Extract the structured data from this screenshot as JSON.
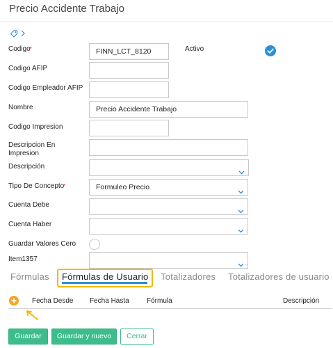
{
  "header": {
    "title": "Precio Accidente Trabajo"
  },
  "form": {
    "codigo": {
      "label": "Codigo",
      "value": "FINN_LCT_8120"
    },
    "activo": {
      "label": "Activo",
      "checked": true
    },
    "codigo_afip": {
      "label": "Codigo AFIP",
      "value": ""
    },
    "codigo_empleador_afip": {
      "label": "Codigo Empleador AFIP",
      "value": ""
    },
    "nombre": {
      "label": "Nombre",
      "value": "Precio Accidente Trabajo"
    },
    "codigo_impresion": {
      "label": "Codigo Impresion",
      "value": ""
    },
    "descripcion_en_impresion": {
      "label_line1": "Descripcion En",
      "label_line2": "Impresion",
      "value": ""
    },
    "descripcion": {
      "label": "Descripción",
      "value": ""
    },
    "tipo_de_concepto": {
      "label": "Tipo De Concepto",
      "value": "Formuleo Precio"
    },
    "cuenta_debe": {
      "label": "Cuenta Debe",
      "value": ""
    },
    "cuenta_haber": {
      "label": "Cuenta Haber",
      "value": ""
    },
    "guardar_valores_cero": {
      "label": "Guardar Valores Cero",
      "checked": false
    },
    "item1357": {
      "label": "Item1357",
      "value": ""
    },
    "required_mark": "*"
  },
  "tabs": [
    {
      "label": "Fórmulas",
      "active": false
    },
    {
      "label": "Fórmulas de Usuario",
      "active": true
    },
    {
      "label": "Totalizadores",
      "active": false
    },
    {
      "label": "Totalizadores de usuario",
      "active": false
    }
  ],
  "grid": {
    "columns": [
      "Fecha Desde",
      "Fecha Hasta",
      "Fórmula",
      "Descripción"
    ]
  },
  "buttons": {
    "save": "Guardar",
    "save_new": "Guardar y nuevo",
    "close": "Cerrar"
  },
  "colors": {
    "accent_blue": "#2c8fd6",
    "primary_green": "#3dbd8b",
    "highlight_yellow": "#f5b800",
    "add_orange": "#f5a623"
  }
}
